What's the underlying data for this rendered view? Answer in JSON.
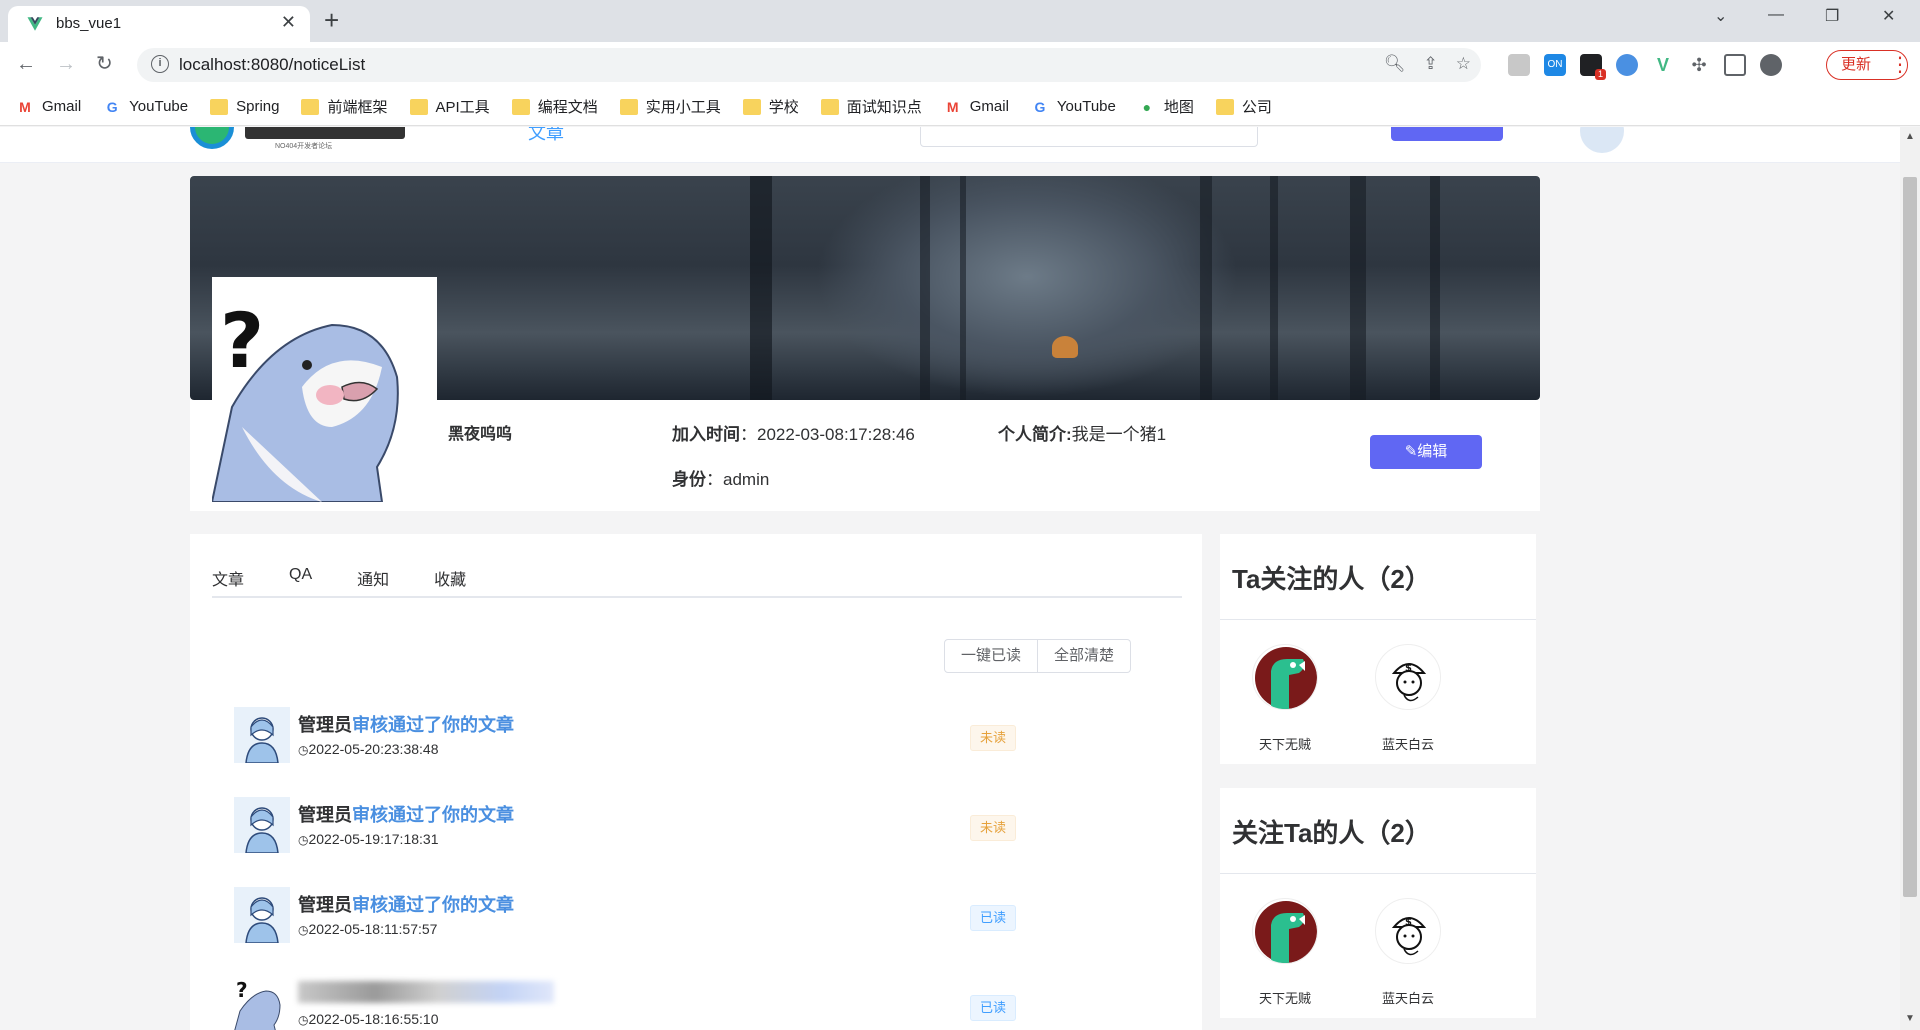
{
  "browser": {
    "tab_title": "bbs_vue1",
    "tab_close": "✕",
    "new_tab": "+",
    "url": "localhost:8080/noticeList",
    "update_label": "更新",
    "window_controls": {
      "minimize": "—",
      "restore": "❐",
      "close": "✕",
      "dropdown": "⌄"
    },
    "bookmarks": [
      {
        "label": "Gmail",
        "icon": "gmail-icon"
      },
      {
        "label": "YouTube",
        "icon": "google-icon"
      },
      {
        "label": "Spring",
        "icon": "folder-icon"
      },
      {
        "label": "前端框架",
        "icon": "folder-icon"
      },
      {
        "label": "API工具",
        "icon": "folder-icon"
      },
      {
        "label": "编程文档",
        "icon": "folder-icon"
      },
      {
        "label": "实用小工具",
        "icon": "folder-icon"
      },
      {
        "label": "学校",
        "icon": "folder-icon"
      },
      {
        "label": "面试知识点",
        "icon": "folder-icon"
      },
      {
        "label": "Gmail",
        "icon": "gmail-icon"
      },
      {
        "label": "YouTube",
        "icon": "google-icon"
      },
      {
        "label": "地图",
        "icon": "maps-icon"
      },
      {
        "label": "公司",
        "icon": "folder-icon"
      }
    ],
    "ext_badge": "ON",
    "ext_count": "1"
  },
  "topnav": {
    "logo_sub": "NO404开发者论坛",
    "nav_article": "文章"
  },
  "profile": {
    "username": "黑夜呜呜",
    "join_label": "加入时间",
    "join_value": "2022-03-08:17:28:46",
    "bio_label": "个人简介:",
    "bio_value": "我是一个猪1",
    "role_label": "身份",
    "role_value": "admin",
    "colon": "：",
    "edit_label": "编辑",
    "edit_icon": "✎"
  },
  "tabs": [
    "文章",
    "QA",
    "通知",
    "收藏"
  ],
  "actions": {
    "mark_all_read": "一键已读",
    "clear_all": "全部清楚"
  },
  "notices": [
    {
      "who": "管理员",
      "what": "审核通过了你的文章",
      "time": "2022-05-20:23:38:48",
      "status": "未读",
      "state": "unread"
    },
    {
      "who": "管理员",
      "what": "审核通过了你的文章",
      "time": "2022-05-19:17:18:31",
      "status": "未读",
      "state": "unread"
    },
    {
      "who": "管理员",
      "what": "审核通过了你的文章",
      "time": "2022-05-18:11:57:57",
      "status": "已读",
      "state": "read"
    },
    {
      "who": "",
      "what": "",
      "time": "2022-05-18:16:55:10",
      "status": "已读",
      "state": "read"
    }
  ],
  "following": {
    "title": "Ta关注的人（2）",
    "users": [
      {
        "name": "天下无贼"
      },
      {
        "name": "蓝天白云"
      }
    ]
  },
  "followers": {
    "title": "关注Ta的人（2）",
    "users": [
      {
        "name": "天下无贼"
      },
      {
        "name": "蓝天白云"
      }
    ]
  },
  "colors": {
    "accent": "#6067f3",
    "link": "#4a8fe0",
    "unread": "#e6a23c",
    "read": "#409eff"
  }
}
